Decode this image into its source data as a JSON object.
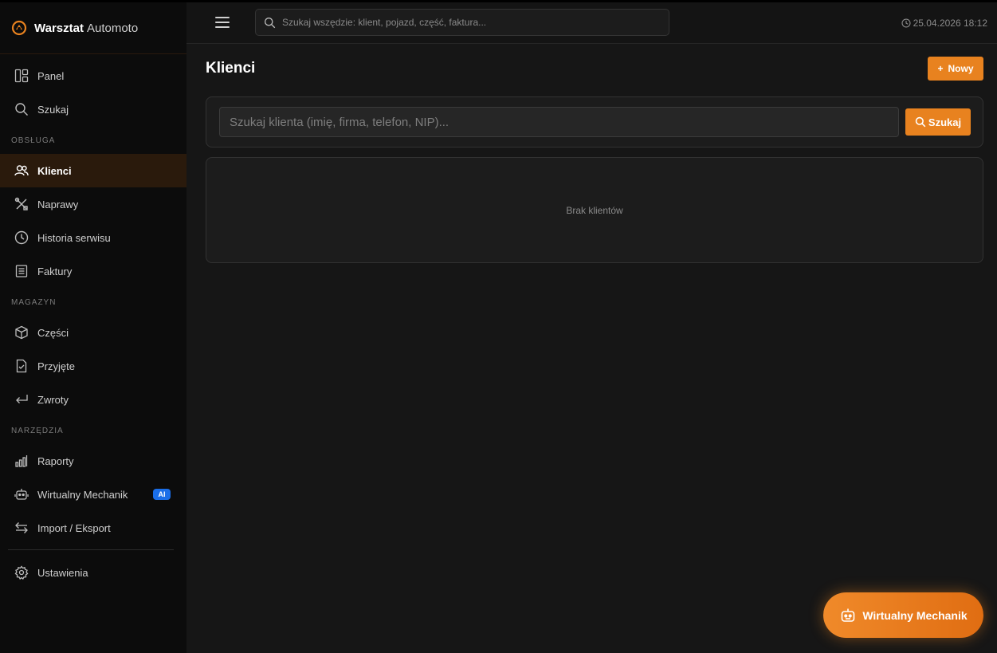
{
  "brand": {
    "name_bold": "Warsztat",
    "name_light": "Automoto",
    "logo_icon": "brand-gear-icon",
    "accent": "#e8821f"
  },
  "sidebar": {
    "items_top": [
      {
        "label": "Panel",
        "icon": "dashboard-icon"
      },
      {
        "label": "Szukaj",
        "icon": "search-icon"
      }
    ],
    "section_obsluga": "OBSŁUGA",
    "items_obsluga": [
      {
        "label": "Klienci",
        "icon": "users-icon",
        "active": true
      },
      {
        "label": "Naprawy",
        "icon": "tools-icon"
      },
      {
        "label": "Historia serwisu",
        "icon": "history-icon"
      },
      {
        "label": "Faktury",
        "icon": "invoice-icon"
      }
    ],
    "section_magazyn": "MAGAZYN",
    "items_magazyn": [
      {
        "label": "Części",
        "icon": "box-icon"
      },
      {
        "label": "Przyjęte",
        "icon": "file-check-icon"
      },
      {
        "label": "Zwroty",
        "icon": "return-icon"
      }
    ],
    "section_narzedzia": "NARZĘDZIA",
    "items_narzedzia": [
      {
        "label": "Raporty",
        "icon": "bar-chart-icon"
      },
      {
        "label": "Wirtualny Mechanik",
        "icon": "robot-icon",
        "badge": "AI"
      },
      {
        "label": "Import / Eksport",
        "icon": "swap-icon"
      }
    ],
    "items_bottom": [
      {
        "label": "Ustawienia",
        "icon": "gear-icon"
      }
    ]
  },
  "header": {
    "search_placeholder": "Szukaj wszędzie: klient, pojazd, część, faktura...",
    "datetime": "25.04.2026 18:12"
  },
  "main": {
    "title": "Klienci",
    "new_button": "Nowy",
    "client_search_placeholder": "Szukaj klienta (imię, firma, telefon, NIP)...",
    "search_button": "Szukaj",
    "empty_text": "Brak klientów"
  },
  "fab": {
    "label": "Wirtualny Mechanik"
  }
}
